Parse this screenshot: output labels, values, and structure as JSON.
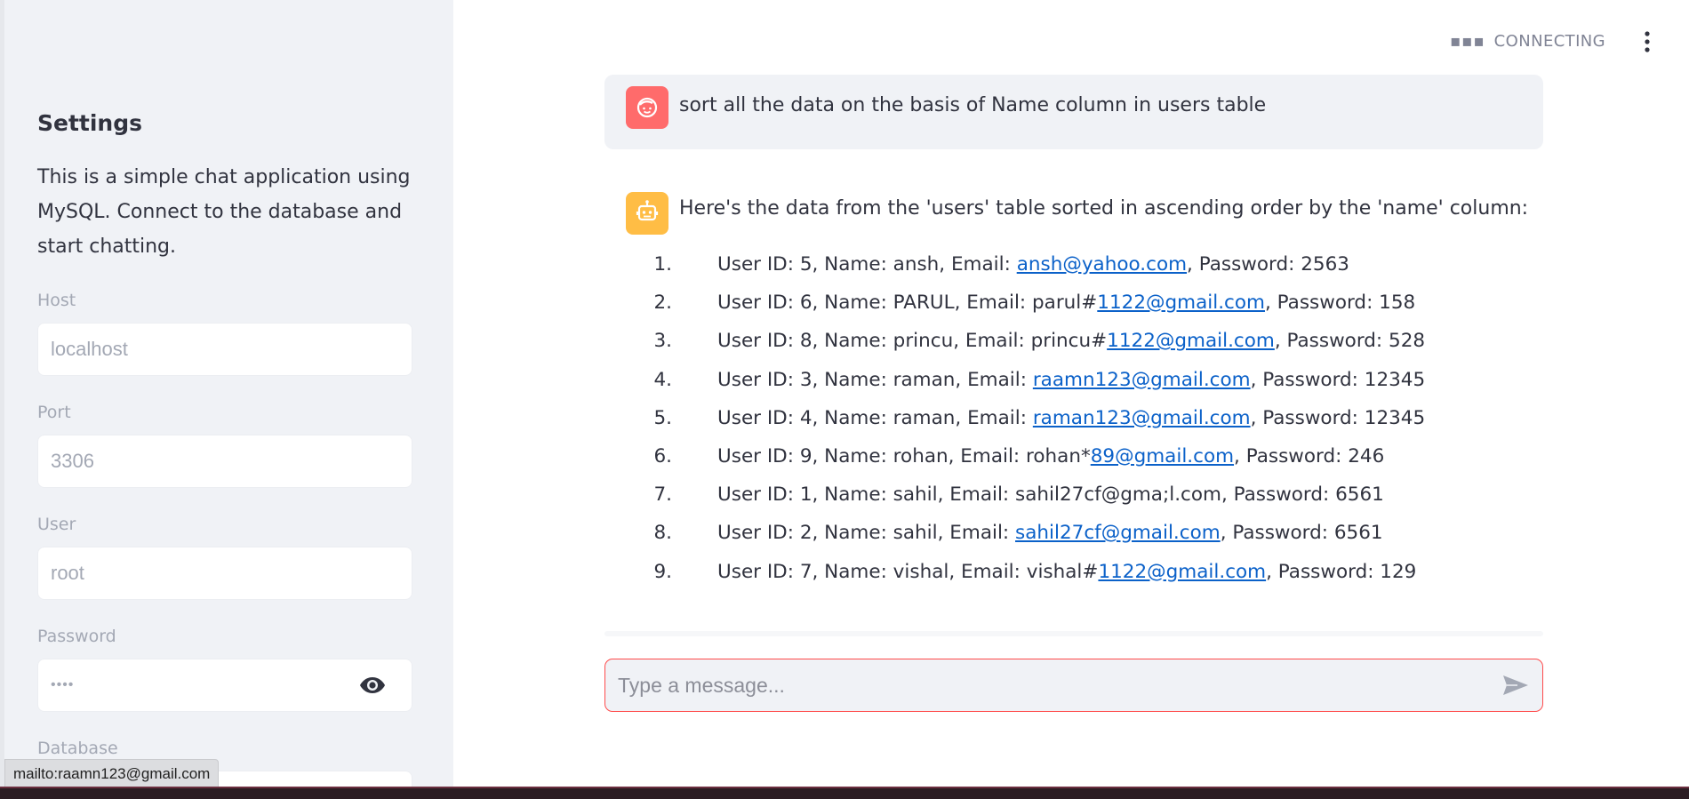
{
  "sidebar": {
    "title": "Settings",
    "description": "This is a simple chat application using MySQL. Connect to the database and start chatting.",
    "fields": {
      "host": {
        "label": "Host",
        "placeholder": "localhost"
      },
      "port": {
        "label": "Port",
        "placeholder": "3306"
      },
      "user": {
        "label": "User",
        "placeholder": "root"
      },
      "password": {
        "label": "Password",
        "value": "••••"
      },
      "database": {
        "label": "Database"
      }
    }
  },
  "header": {
    "status": "CONNECTING"
  },
  "chat": {
    "user_message": "sort all the data on the basis of Name column in users table",
    "bot_intro": "Here's the data from the 'users' table sorted in ascending order by the 'name' column:",
    "rows": [
      {
        "num": "1.",
        "pre": "User ID: 5, Name: ansh, Email: ",
        "link": "ansh@yahoo.com",
        "post": ", Password: 2563"
      },
      {
        "num": "2.",
        "pre": "User ID: 6, Name: PARUL, Email: parul#",
        "link": "1122@gmail.com",
        "post": ", Password: 158"
      },
      {
        "num": "3.",
        "pre": "User ID: 8, Name: princu, Email: princu#",
        "link": "1122@gmail.com",
        "post": ", Password: 528"
      },
      {
        "num": "4.",
        "pre": "User ID: 3, Name: raman, Email: ",
        "link": "raamn123@gmail.com",
        "post": ", Password: 12345"
      },
      {
        "num": "5.",
        "pre": "User ID: 4, Name: raman, Email: ",
        "link": "raman123@gmail.com",
        "post": ", Password: 12345"
      },
      {
        "num": "6.",
        "pre": "User ID: 9, Name: rohan, Email: rohan*",
        "link": "89@gmail.com",
        "post": ", Password: 246"
      },
      {
        "num": "7.",
        "pre": "User ID: 1, Name: sahil, Email: sahil27cf@gma;l.com, Password: 6561",
        "link": "",
        "post": ""
      },
      {
        "num": "8.",
        "pre": "User ID: 2, Name: sahil, Email: ",
        "link": "sahil27cf@gmail.com",
        "post": ", Password: 6561"
      },
      {
        "num": "9.",
        "pre": "User ID: 7, Name: vishal, Email: vishal#",
        "link": "1122@gmail.com",
        "post": ", Password: 129"
      }
    ],
    "input_placeholder": "Type a message..."
  },
  "status_tooltip": "mailto:raamn123@gmail.com",
  "icons": {
    "connecting": "dots-icon",
    "menu": "kebab-menu-icon",
    "user_avatar": "user-face-icon",
    "bot_avatar": "robot-icon",
    "password_toggle": "eye-icon",
    "send": "send-icon"
  },
  "colors": {
    "sidebar_bg": "#f0f2f6",
    "accent": "#ff4b4b",
    "user_avatar": "#ff6b6b",
    "bot_avatar": "#ffbd45",
    "link": "#0b61c9"
  }
}
